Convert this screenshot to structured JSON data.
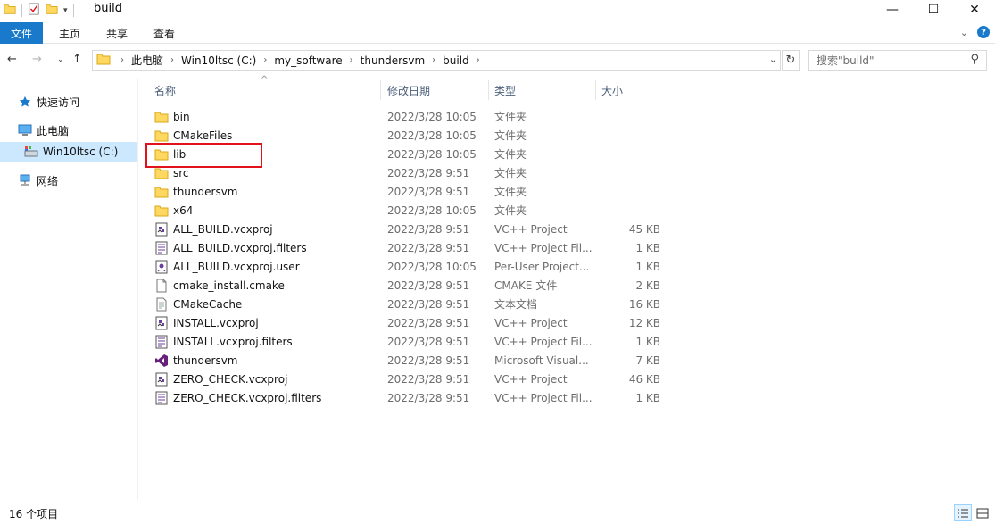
{
  "window": {
    "title": "build",
    "controls": {
      "minimize": "—",
      "maximize": "☐",
      "close": "✕"
    }
  },
  "ribbon": {
    "tabs": [
      "文件",
      "主页",
      "共享",
      "查看"
    ]
  },
  "address": {
    "crumbs": [
      "此电脑",
      "Win10ltsc (C:)",
      "my_software",
      "thundersvm",
      "build"
    ],
    "search_placeholder": "搜索\"build\""
  },
  "nav": {
    "items": [
      {
        "label": "快速访问",
        "icon": "star-icon"
      },
      {
        "label": "此电脑",
        "icon": "computer-icon"
      },
      {
        "label": "Win10ltsc (C:)",
        "icon": "drive-icon"
      },
      {
        "label": "网络",
        "icon": "network-icon"
      }
    ]
  },
  "columns": {
    "name": "名称",
    "date": "修改日期",
    "type": "类型",
    "size": "大小"
  },
  "files": [
    {
      "name": "bin",
      "date": "2022/3/28 10:05",
      "type": "文件夹",
      "size": "",
      "icon": "folder-icon"
    },
    {
      "name": "CMakeFiles",
      "date": "2022/3/28 10:05",
      "type": "文件夹",
      "size": "",
      "icon": "folder-icon"
    },
    {
      "name": "lib",
      "date": "2022/3/28 10:05",
      "type": "文件夹",
      "size": "",
      "icon": "folder-icon"
    },
    {
      "name": "src",
      "date": "2022/3/28 9:51",
      "type": "文件夹",
      "size": "",
      "icon": "folder-icon"
    },
    {
      "name": "thundersvm",
      "date": "2022/3/28 9:51",
      "type": "文件夹",
      "size": "",
      "icon": "folder-icon"
    },
    {
      "name": "x64",
      "date": "2022/3/28 10:05",
      "type": "文件夹",
      "size": "",
      "icon": "folder-icon"
    },
    {
      "name": "ALL_BUILD.vcxproj",
      "date": "2022/3/28 9:51",
      "type": "VC++ Project",
      "size": "45 KB",
      "icon": "vcxproj-icon"
    },
    {
      "name": "ALL_BUILD.vcxproj.filters",
      "date": "2022/3/28 9:51",
      "type": "VC++ Project Fil...",
      "size": "1 KB",
      "icon": "filters-icon"
    },
    {
      "name": "ALL_BUILD.vcxproj.user",
      "date": "2022/3/28 10:05",
      "type": "Per-User Project...",
      "size": "1 KB",
      "icon": "user-project-icon"
    },
    {
      "name": "cmake_install.cmake",
      "date": "2022/3/28 9:51",
      "type": "CMAKE 文件",
      "size": "2 KB",
      "icon": "blank-file-icon"
    },
    {
      "name": "CMakeCache",
      "date": "2022/3/28 9:51",
      "type": "文本文档",
      "size": "16 KB",
      "icon": "text-file-icon"
    },
    {
      "name": "INSTALL.vcxproj",
      "date": "2022/3/28 9:51",
      "type": "VC++ Project",
      "size": "12 KB",
      "icon": "vcxproj-icon"
    },
    {
      "name": "INSTALL.vcxproj.filters",
      "date": "2022/3/28 9:51",
      "type": "VC++ Project Fil...",
      "size": "1 KB",
      "icon": "filters-icon"
    },
    {
      "name": "thundersvm",
      "date": "2022/3/28 9:51",
      "type": "Microsoft Visual...",
      "size": "7 KB",
      "icon": "visual-studio-icon"
    },
    {
      "name": "ZERO_CHECK.vcxproj",
      "date": "2022/3/28 9:51",
      "type": "VC++ Project",
      "size": "46 KB",
      "icon": "vcxproj-icon"
    },
    {
      "name": "ZERO_CHECK.vcxproj.filters",
      "date": "2022/3/28 9:51",
      "type": "VC++ Project Fil...",
      "size": "1 KB",
      "icon": "filters-icon"
    }
  ],
  "status": {
    "count": "16 个项目"
  },
  "colors": {
    "accent": "#1979ca",
    "folder": "#ffd862",
    "highlight": "#e1121b",
    "selected": "#cce8ff"
  }
}
